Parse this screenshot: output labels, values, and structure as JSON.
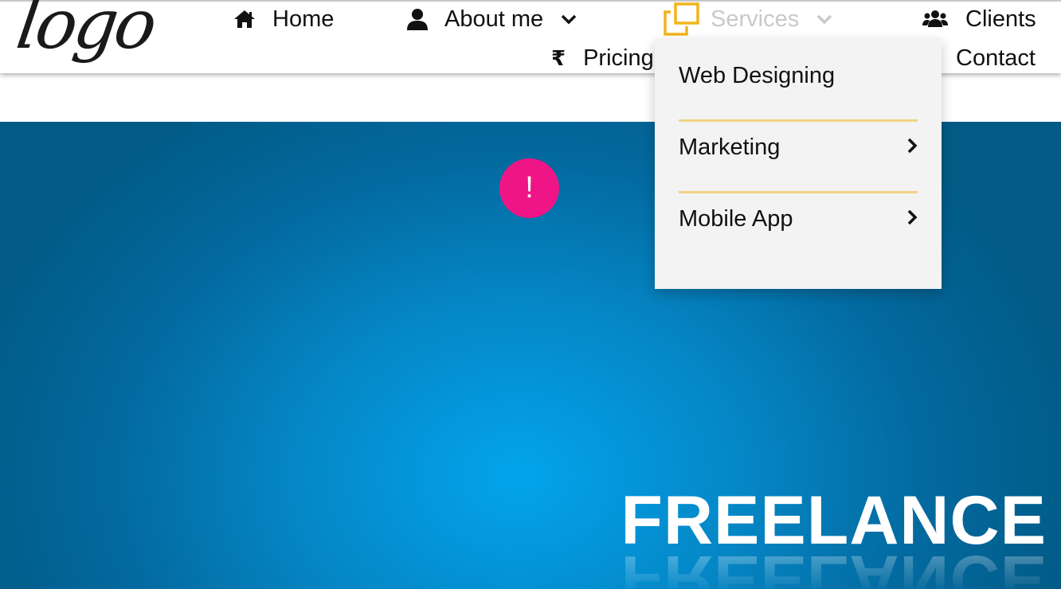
{
  "logo": {
    "text": "logo"
  },
  "nav": {
    "home": {
      "label": "Home",
      "icon": "home-icon"
    },
    "about": {
      "label": "About me",
      "icon": "user-icon"
    },
    "services": {
      "label": "Services",
      "icon": "copy-icon",
      "icon_color": "#f2b31b"
    },
    "clients": {
      "label": "Clients",
      "icon": "users-icon"
    },
    "pricing": {
      "label": "Pricing",
      "icon": "rupee-icon",
      "icon_glyph": "₹"
    },
    "contact": {
      "label": "Contact"
    }
  },
  "services_menu": {
    "items": [
      {
        "label": "Web Designing",
        "has_submenu": false
      },
      {
        "label": "Marketing",
        "has_submenu": true
      },
      {
        "label": "Mobile App",
        "has_submenu": true
      }
    ],
    "separator_color": "#f0d384"
  },
  "hero": {
    "alert_symbol": "!",
    "alert_color": "#ef1587",
    "title": "FREELANCE",
    "background_color": "#03a4ec"
  }
}
